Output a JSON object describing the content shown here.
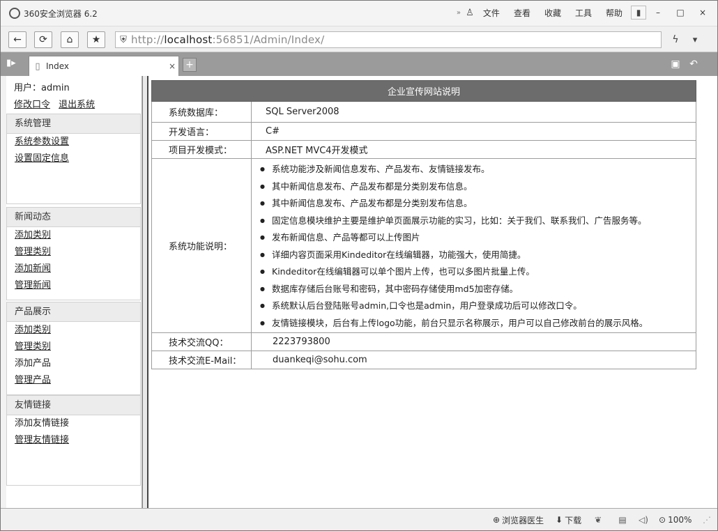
{
  "browser": {
    "title": "360安全浏览器 6.2",
    "menu": [
      "文件",
      "查看",
      "收藏",
      "工具",
      "帮助"
    ],
    "url_scheme": "http://",
    "url_host": "localhost",
    "url_rest": ":56851/Admin/Index/",
    "tab_label": "Index",
    "controls": {
      "back": "←",
      "refresh": "⟳",
      "home": "⌂",
      "favorite": "★",
      "shield": "⛨",
      "bolt": "ϟ",
      "dropdown": "▾",
      "minimize": "–",
      "maximize": "□",
      "close": "×",
      "skin": "▮",
      "pin": "»",
      "user": "♙",
      "tab_page": "▯",
      "tab_close": "×",
      "new_tab": "+",
      "sidebar": "▮▸",
      "restore_tab": "▣",
      "undo": "↶"
    }
  },
  "sidebar": {
    "user_line": "用户：admin",
    "change_password": "修改口令",
    "logout": "退出系统",
    "sections": [
      {
        "title": "系统管理",
        "items": [
          "系统参数设置",
          "设置固定信息"
        ]
      },
      {
        "title": "新闻动态",
        "items": [
          "添加类别",
          "管理类别",
          "添加新闻",
          "管理新闻"
        ]
      },
      {
        "title": "产品展示",
        "items": [
          "添加类别",
          "管理类别",
          "添加产品",
          "管理产品"
        ]
      },
      {
        "title": "友情链接",
        "items": [
          "添加友情链接",
          "管理友情链接"
        ]
      }
    ]
  },
  "main": {
    "table_title": "企业宣传网站说明",
    "rows": {
      "db_label": "系统数据库：",
      "db_value": "SQL Server2008",
      "lang_label": "开发语言：",
      "lang_value": "C#",
      "mode_label": "项目开发模式：",
      "mode_value": "ASP.NET MVC4开发模式",
      "feature_label": "系统功能说明：",
      "qq_label": "技术交流QQ：",
      "qq_value": "2223793800",
      "email_label": "技术交流E-Mail：",
      "email_value": "duankeqi@sohu.com"
    },
    "features": [
      "系统功能涉及新闻信息发布、产品发布、友情链接发布。",
      "其中新闻信息发布、产品发布都是分类别发布信息。",
      "其中新闻信息发布、产品发布都是分类别发布信息。",
      "固定信息模块维护主要是维护单页面展示功能的实习，比如：关于我们、联系我们、广告服务等。",
      "发布新闻信息、产品等都可以上传图片",
      "详细内容页面采用Kindeditor在线编辑器，功能强大，使用简捷。",
      "Kindeditor在线编辑器可以单个图片上传，也可以多图片批量上传。",
      "数据库存储后台账号和密码，其中密码存储使用md5加密存储。",
      "系统默认后台登陆账号admin,口令也是admin，用户登录成功后可以修改口令。",
      "友情链接模块，后台有上传logo功能，前台只显示名称展示，用户可以自己修改前台的展示风格。"
    ]
  },
  "status": {
    "doctor": "浏览器医生",
    "download": "下载",
    "zoom": "100%"
  }
}
